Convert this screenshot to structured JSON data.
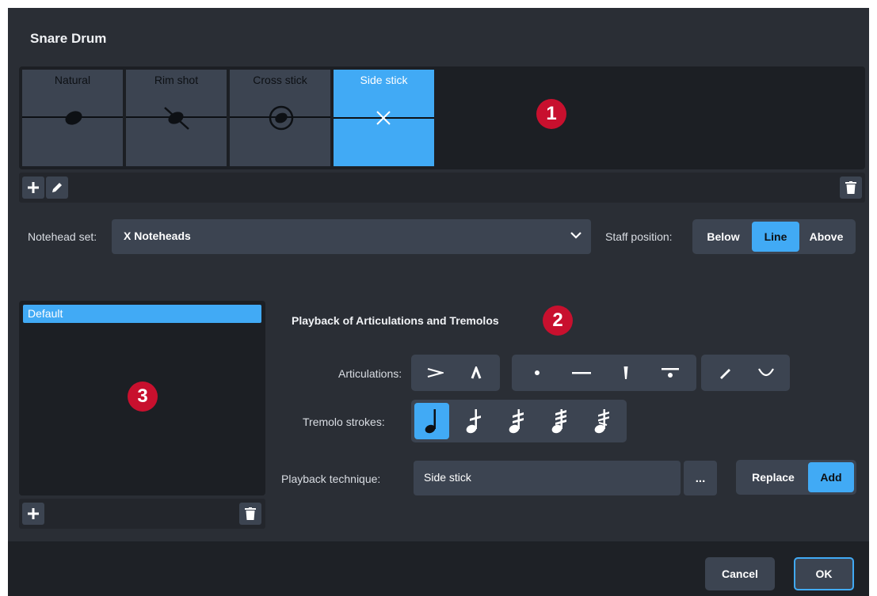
{
  "dialog": {
    "title": "Snare Drum"
  },
  "techniques": {
    "items": [
      {
        "label": "Natural",
        "notehead": "filled-notehead-icon"
      },
      {
        "label": "Rim shot",
        "notehead": "slashed-notehead-icon"
      },
      {
        "label": "Cross stick",
        "notehead": "circled-notehead-icon"
      },
      {
        "label": "Side stick",
        "notehead": "x-notehead-icon"
      }
    ],
    "selected": "Side stick"
  },
  "notehead": {
    "label": "Notehead set:",
    "value": "X Noteheads"
  },
  "staff_position": {
    "label": "Staff position:",
    "options": [
      "Below",
      "Line",
      "Above"
    ],
    "selected": "Line"
  },
  "playback_list": {
    "items": [
      "Default"
    ],
    "selected": "Default"
  },
  "playback_section": {
    "heading": "Playback of Articulations and Tremolos",
    "articulations_label": "Articulations:",
    "tremolo_label": "Tremolo strokes:",
    "tremolo_selected": 0,
    "technique_label": "Playback technique:",
    "technique_value": "Side stick",
    "more_label": "...",
    "mode_options": [
      "Replace",
      "Add"
    ],
    "mode_selected": "Add"
  },
  "callouts": [
    "1",
    "2",
    "3"
  ],
  "footer": {
    "cancel": "Cancel",
    "ok": "OK"
  },
  "colors": {
    "accent": "#41aaf5",
    "panel": "#2a2e35",
    "control": "#3c4451",
    "callout": "#c8102e"
  }
}
